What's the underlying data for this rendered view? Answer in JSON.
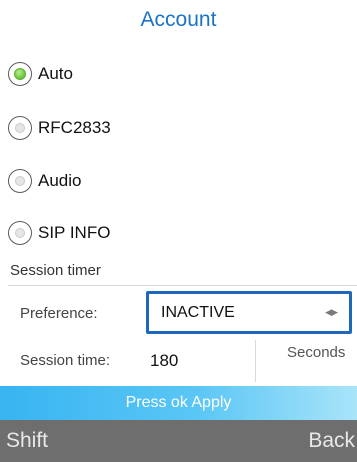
{
  "header": {
    "title": "Account"
  },
  "dtmf_options": [
    {
      "label": "Auto",
      "selected": true
    },
    {
      "label": "RFC2833",
      "selected": false
    },
    {
      "label": "Audio",
      "selected": false
    },
    {
      "label": "SIP INFO",
      "selected": false
    }
  ],
  "session_timer": {
    "section_label": "Session timer",
    "preference_label": "Preference:",
    "preference_value": "INACTIVE",
    "preference_icon": "left-right-arrows-icon",
    "time_label": "Session time:",
    "time_value": "180",
    "time_unit": "Seconds"
  },
  "hint": {
    "text": "Press ok Apply"
  },
  "softkeys": {
    "left": "Shift",
    "right": "Back"
  },
  "colors": {
    "title": "#1a73c9",
    "focus_border": "#1f67bd",
    "hint_bar": "#38b4f1",
    "softkey_bar": "#6e6e6e",
    "radio_selected": "#68c23a"
  }
}
